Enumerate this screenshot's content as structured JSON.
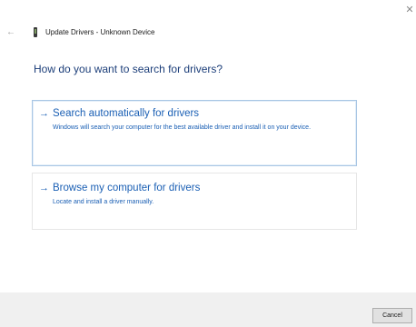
{
  "window": {
    "title": "Update Drivers - Unknown Device",
    "close_icon": "close-icon",
    "back_icon": "back-arrow-icon",
    "device_icon": "device-icon"
  },
  "main": {
    "heading": "How do you want to search for drivers?",
    "options": [
      {
        "arrow": "→",
        "title": "Search automatically for drivers",
        "description": "Windows will search your computer for the best available driver and install it on your device."
      },
      {
        "arrow": "→",
        "title": "Browse my computer for drivers",
        "description": "Locate and install a driver manually."
      }
    ]
  },
  "footer": {
    "cancel_label": "Cancel"
  },
  "colors": {
    "link_blue": "#1a5fb4",
    "heading_blue": "#1d3f7a",
    "selected_border": "#a9c6e4",
    "footer_bg": "#f0f0f0"
  }
}
